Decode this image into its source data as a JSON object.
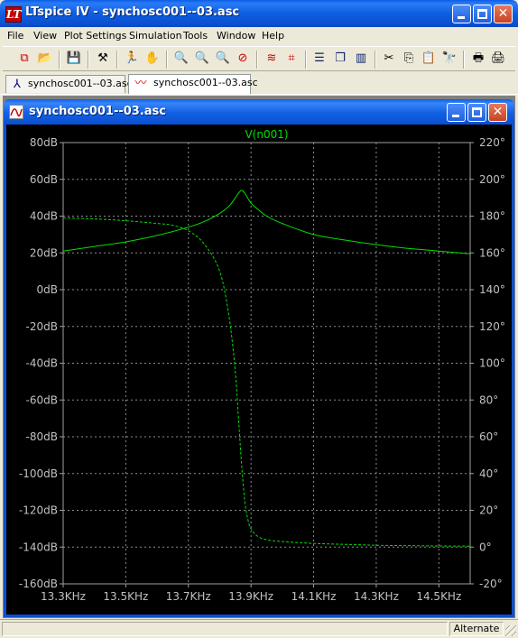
{
  "window": {
    "app_icon_letter": "LT",
    "title": "LTspice IV - synchosc001--03.asc"
  },
  "menu": [
    "File",
    "View",
    "Plot Settings",
    "Simulation",
    "Tools",
    "Window",
    "Help"
  ],
  "toolbar": {
    "buttons": [
      "new-schematic-icon",
      "open-folder-icon",
      "save-icon",
      "control-panel-icon",
      "run-icon",
      "halt-hand-icon",
      "zoom-in-icon",
      "zoom-to-fit-icon",
      "zoom-out-icon",
      "cancel-zoom-icon",
      "autorange-icon",
      "mark-trace-icon",
      "tile-horizontal-icon",
      "cascade-icon",
      "tile-vertical-icon",
      "cut-icon",
      "copy-icon",
      "paste-icon",
      "find-icon",
      "print-preview-icon",
      "print-icon"
    ]
  },
  "tabs": [
    {
      "label": "synchosc001--03.asc",
      "icon": "schematic-icon",
      "active": false
    },
    {
      "label": "synchosc001--03.asc",
      "icon": "waveform-icon",
      "active": true
    }
  ],
  "child_window": {
    "title": "synchosc001--03.asc"
  },
  "colors": {
    "plot_bg": "#000000",
    "grid": "#8c8c8c",
    "trace": "#00e000",
    "axis_text": "#c0c0c0",
    "title_green": "#00e000"
  },
  "chart_data": {
    "type": "line",
    "title": "V(n001)",
    "x_tick_labels": [
      "13.3KHz",
      "13.5KHz",
      "13.7KHz",
      "13.9KHz",
      "14.1KHz",
      "14.3KHz",
      "14.5KHz"
    ],
    "x_ticks": [
      13.3,
      13.5,
      13.7,
      13.9,
      14.1,
      14.3,
      14.5
    ],
    "xlim": [
      13.3,
      14.6
    ],
    "y_left_tick_labels": [
      "80dB",
      "60dB",
      "40dB",
      "20dB",
      "0dB",
      "-20dB",
      "-40dB",
      "-60dB",
      "-80dB",
      "-100dB",
      "-120dB",
      "-140dB",
      "-160dB"
    ],
    "y_left_ticks": [
      80,
      60,
      40,
      20,
      0,
      -20,
      -40,
      -60,
      -80,
      -100,
      -120,
      -140,
      -160
    ],
    "ylim_left": [
      -160,
      80
    ],
    "y_right_tick_labels": [
      "220°",
      "200°",
      "180°",
      "160°",
      "140°",
      "120°",
      "100°",
      "80°",
      "60°",
      "40°",
      "20°",
      "0°",
      "-20°"
    ],
    "y_right_ticks": [
      220,
      200,
      180,
      160,
      140,
      120,
      100,
      80,
      60,
      40,
      20,
      0,
      -20
    ],
    "ylim_right": [
      -20,
      220
    ],
    "grid": true,
    "series": [
      {
        "name": "V(n001)",
        "kind": "magnitude",
        "style": "solid",
        "unit": "dB",
        "x": [
          13.3,
          13.4,
          13.5,
          13.6,
          13.7,
          13.75,
          13.8,
          13.83,
          13.85,
          13.86,
          13.87,
          13.88,
          13.9,
          13.92,
          13.95,
          14.0,
          14.1,
          14.2,
          14.3,
          14.4,
          14.5,
          14.6
        ],
        "y": [
          21,
          23.5,
          26,
          29.5,
          34,
          37,
          41.5,
          45.5,
          50,
          52.5,
          54,
          52.5,
          47,
          44,
          40,
          36,
          30,
          27,
          24.5,
          22.5,
          21,
          19.5
        ]
      },
      {
        "name": "V(n001)",
        "kind": "phase",
        "style": "dashed",
        "unit": "°",
        "x": [
          13.3,
          13.4,
          13.5,
          13.6,
          13.65,
          13.7,
          13.75,
          13.8,
          13.83,
          13.85,
          13.86,
          13.87,
          13.88,
          13.89,
          13.9,
          13.92,
          13.95,
          14.0,
          14.1,
          14.2,
          14.3,
          14.4,
          14.5,
          14.6
        ],
        "y": [
          179,
          178.5,
          177.5,
          176,
          175,
          172,
          165,
          150,
          125,
          95,
          70,
          45,
          25,
          15,
          10,
          6,
          4,
          3,
          2,
          1.5,
          1,
          0.8,
          0.6,
          0.5
        ]
      }
    ]
  },
  "status": {
    "message": "",
    "mode": "Alternate"
  }
}
